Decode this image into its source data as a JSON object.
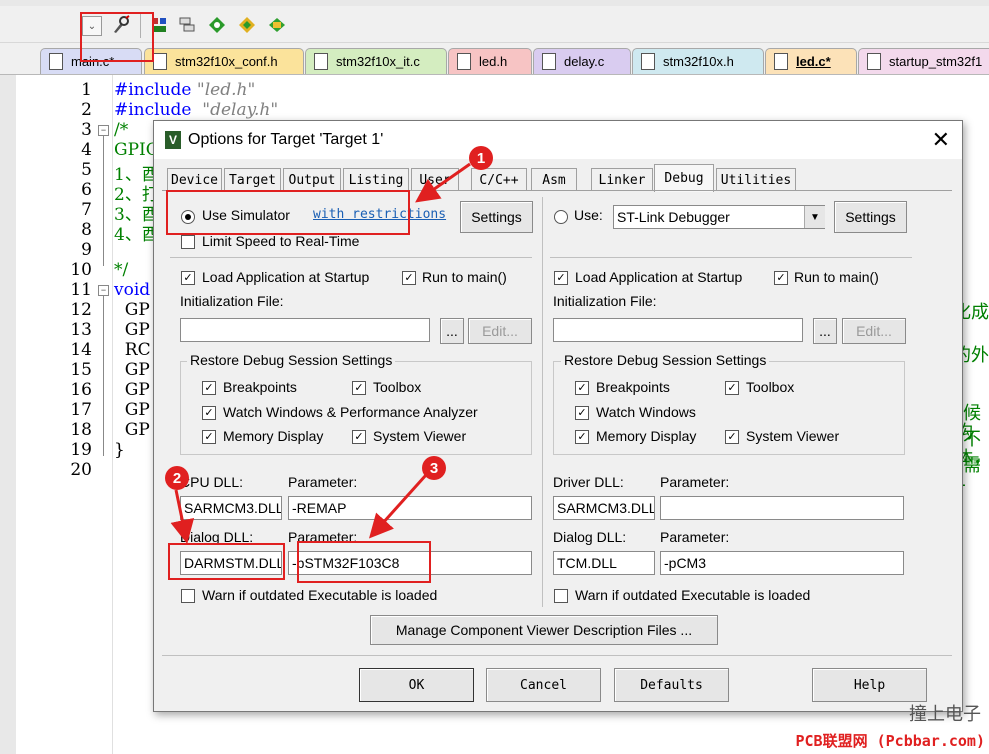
{
  "toolbar": {
    "buttons": [
      "dropdown",
      "options-for-target-icon",
      "load-icon",
      "manage-icon",
      "debug-icon",
      "component-icon",
      "pack-icon"
    ]
  },
  "tabs": [
    {
      "label": "main.c*"
    },
    {
      "label": "stm32f10x_conf.h"
    },
    {
      "label": "stm32f10x_it.c"
    },
    {
      "label": "led.h"
    },
    {
      "label": "delay.c"
    },
    {
      "label": "stm32f10x.h"
    },
    {
      "label": "led.c*"
    },
    {
      "label": "startup_stm32f1"
    }
  ],
  "editor": {
    "line_numbers": [
      "1",
      "2",
      "3",
      "4",
      "5",
      "6",
      "7",
      "8",
      "9",
      "10",
      "11",
      "12",
      "13",
      "14",
      "15",
      "16",
      "17",
      "18",
      "19",
      "20"
    ],
    "lines": [
      {
        "kw": "#include ",
        "str": "\"led.h\""
      },
      {
        "kw": "#include ",
        "str": " \"delay.h\""
      },
      {
        "cm": "/*"
      },
      {
        "cm": "GPIO"
      },
      {
        "cm": "1、酉"
      },
      {
        "cm": "2、打"
      },
      {
        "cm": "3、酉"
      },
      {
        "cm": "4、酉"
      },
      {
        "cm": ""
      },
      {
        "cm": "*/"
      },
      {
        "kw": "void"
      },
      {
        "code": "  GP"
      },
      {
        "code": "  GP"
      },
      {
        "code": "  RC"
      },
      {
        "code": "  GP"
      },
      {
        "code": "  GP"
      },
      {
        "code": "  GP"
      },
      {
        "code": "  GP"
      },
      {
        "code": "}"
      },
      {
        "code": ""
      }
    ],
    "right_comments": [
      "始化成",
      "同的外",
      "候不需",
      "构体，L"
    ]
  },
  "dialog": {
    "title": "Options for Target 'Target 1'",
    "tabs": [
      "Device",
      "Target",
      "Output",
      "Listing",
      "User",
      "C/C++",
      "Asm",
      "Linker",
      "Debug",
      "Utilities"
    ],
    "active_tab": "Debug",
    "left": {
      "use_simulator": "Use Simulator",
      "restrictions_link": "with restrictions",
      "settings": "Settings",
      "limit_speed": "Limit Speed to Real-Time",
      "load_app": "Load Application at Startup",
      "run_to_main": "Run to main()",
      "init_file_label": "Initialization File:",
      "browse": "...",
      "edit": "Edit...",
      "restore_title": "Restore Debug Session Settings",
      "breakpoints": "Breakpoints",
      "toolbox": "Toolbox",
      "watch": "Watch Windows & Performance Analyzer",
      "memory": "Memory Display",
      "system_viewer": "System Viewer",
      "cpu_dll_label": "CPU DLL:",
      "cpu_dll": "SARMCM3.DLL",
      "cpu_param_label": "Parameter:",
      "cpu_param": "-REMAP",
      "dialog_dll_label": "Dialog DLL:",
      "dialog_dll": "DARMSTM.DLL",
      "dialog_param_label": "Parameter:",
      "dialog_param": "-pSTM32F103C8",
      "warn": "Warn if outdated Executable is loaded"
    },
    "right": {
      "use": "Use:",
      "debugger": "ST-Link Debugger",
      "settings": "Settings",
      "load_app": "Load Application at Startup",
      "run_to_main": "Run to main()",
      "init_file_label": "Initialization File:",
      "browse": "...",
      "edit": "Edit...",
      "restore_title": "Restore Debug Session Settings",
      "breakpoints": "Breakpoints",
      "toolbox": "Toolbox",
      "watch": "Watch Windows",
      "memory": "Memory Display",
      "system_viewer": "System Viewer",
      "driver_dll_label": "Driver DLL:",
      "driver_dll": "SARMCM3.DLL",
      "driver_param_label": "Parameter:",
      "driver_param": "",
      "dialog_dll_label": "Dialog DLL:",
      "dialog_dll": "TCM.DLL",
      "dialog_param_label": "Parameter:",
      "dialog_param": "-pCM3",
      "warn": "Warn if outdated Executable is loaded"
    },
    "manage_button": "Manage Component Viewer Description Files ...",
    "ok": "OK",
    "cancel": "Cancel",
    "defaults": "Defaults",
    "help": "Help"
  },
  "annotations": {
    "badge1": "1",
    "badge2": "2",
    "badge3": "3",
    "accent": "#e02020"
  },
  "watermark": {
    "text": "撞上电子",
    "site": "PCB联盟网 (Pcbbar.com)"
  }
}
